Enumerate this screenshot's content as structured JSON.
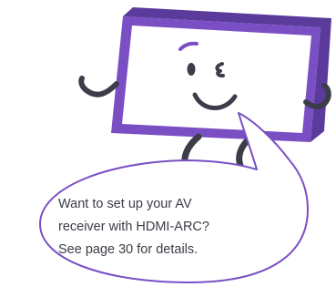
{
  "colors": {
    "tv_frame": "#7a4fc4",
    "tv_side": "#5a3a9a",
    "screen": "#ffffff",
    "face": "#3d3d4a",
    "cheek_line": "#7a4fc4",
    "bubble_outline": "#7a4fc4",
    "text": "#3c3c46"
  },
  "illustration": {
    "mascot": "tv-mascot-winking",
    "expression": "wink-smile"
  },
  "speech_bubble": {
    "lines": [
      "Want to set up your AV",
      "receiver with HDMI-ARC?",
      "See page 30 for details."
    ]
  }
}
